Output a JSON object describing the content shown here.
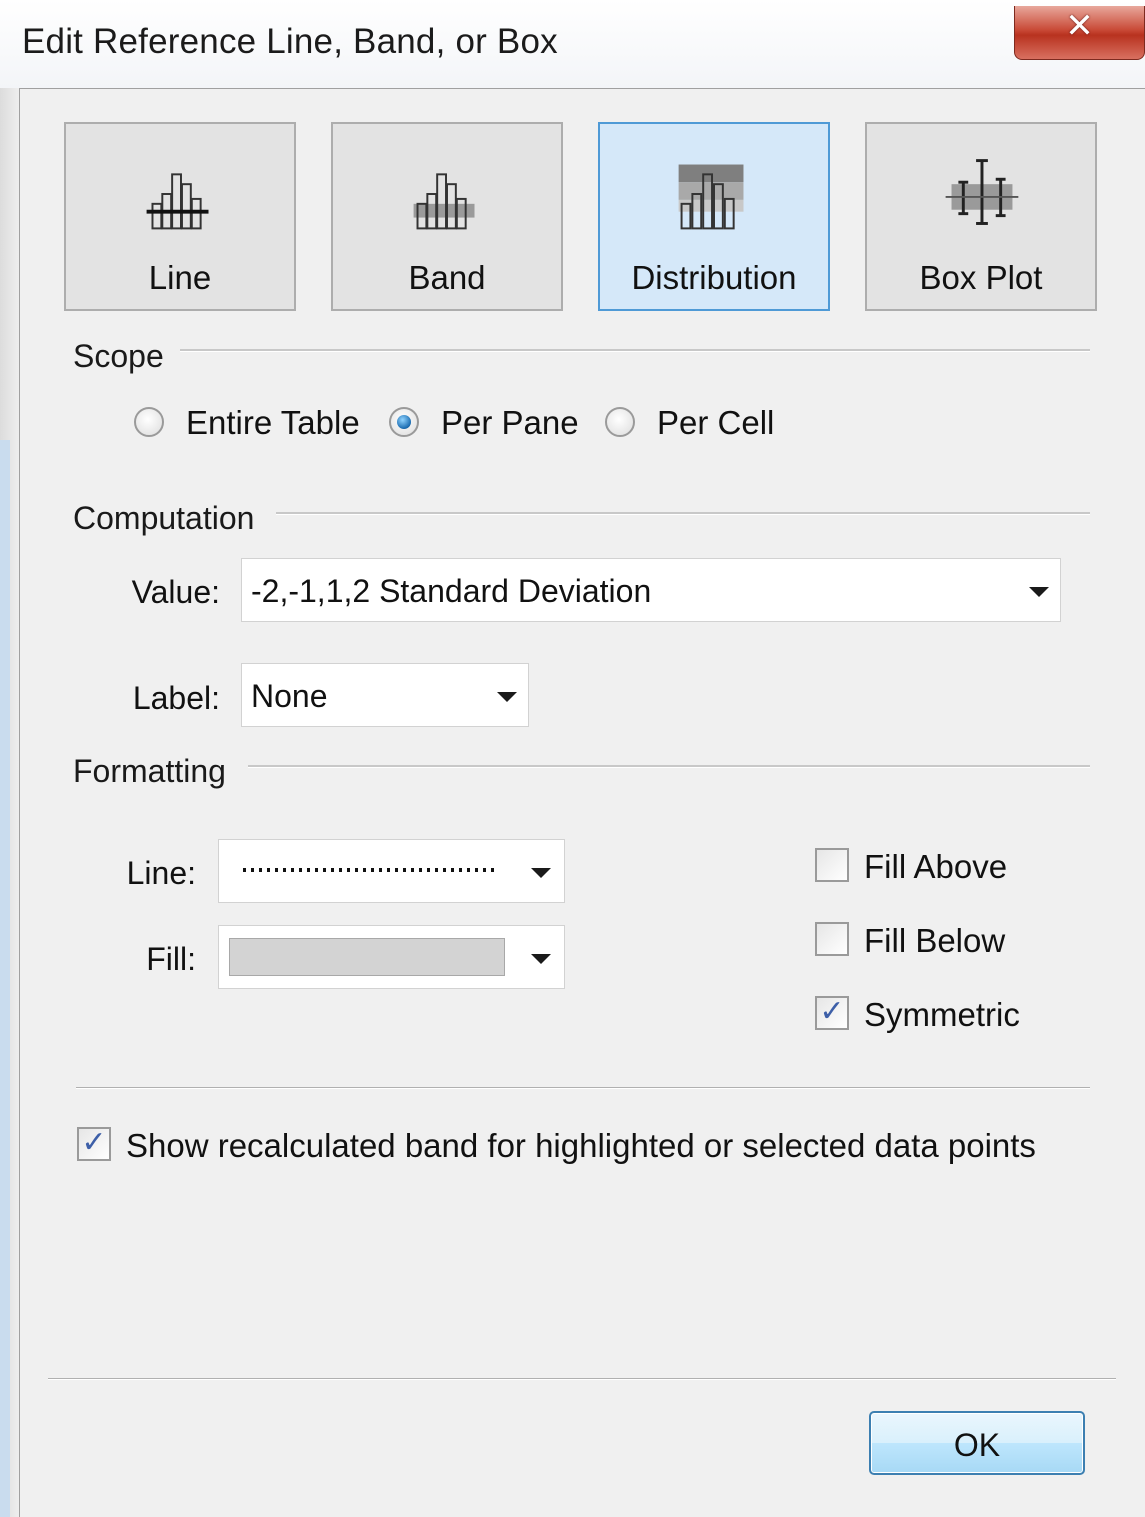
{
  "window": {
    "title": "Edit Reference Line, Band, or Box",
    "close_icon": "close-icon"
  },
  "types": [
    {
      "label": "Line",
      "icon": "reference-line-icon",
      "selected": false
    },
    {
      "label": "Band",
      "icon": "reference-band-icon",
      "selected": false
    },
    {
      "label": "Distribution",
      "icon": "distribution-icon",
      "selected": true
    },
    {
      "label": "Box Plot",
      "icon": "box-plot-icon",
      "selected": false
    }
  ],
  "scope": {
    "heading": "Scope",
    "options": [
      {
        "label": "Entire Table",
        "checked": false
      },
      {
        "label": "Per Pane",
        "checked": true
      },
      {
        "label": "Per Cell",
        "checked": false
      }
    ]
  },
  "computation": {
    "heading": "Computation",
    "value_label": "Value:",
    "value": "-2,-1,1,2 Standard Deviation",
    "label_label": "Label:",
    "label_value": "None"
  },
  "formatting": {
    "heading": "Formatting",
    "line_label": "Line:",
    "line_style": "dotted",
    "fill_label": "Fill:",
    "fill_color": "#d3d3d3",
    "fill_above": {
      "label": "Fill Above",
      "checked": false
    },
    "fill_below": {
      "label": "Fill Below",
      "checked": false
    },
    "symmetric": {
      "label": "Symmetric",
      "checked": true
    }
  },
  "show_recalculated": {
    "label": "Show recalculated band for highlighted or selected data points",
    "checked": true
  },
  "ok_label": "OK",
  "colors": {
    "selected_bg": "#d5e8f9",
    "selected_border": "#4f9ad6",
    "close_red": "#c94a37",
    "check_blue": "#3d5fa8"
  }
}
